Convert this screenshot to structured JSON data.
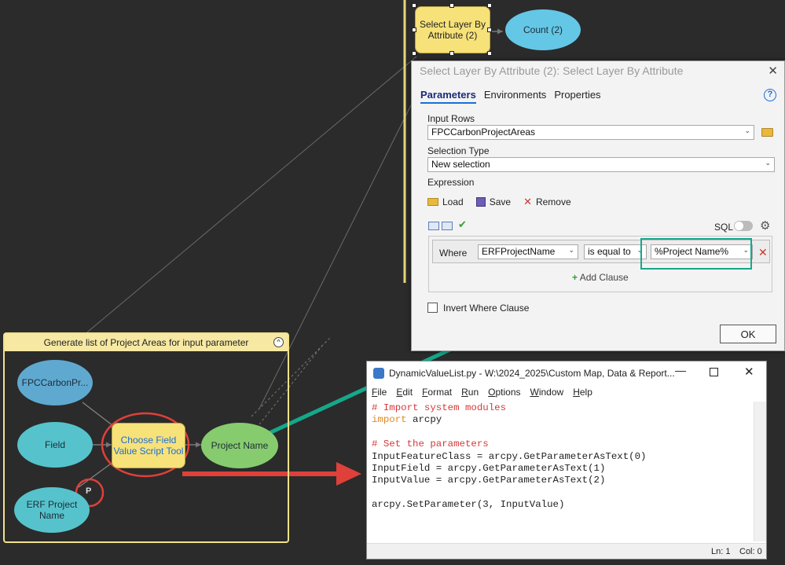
{
  "model": {
    "nodes": {
      "select_layer": "Select Layer By Attribute (2)",
      "count": "Count (2)",
      "fpc_carbon": "FPCCarbonPr...",
      "field": "Field",
      "choose_field": "Choose Field Value Script Tool",
      "project_name": "Project Name",
      "erf_project_name": "ERF Project Name",
      "param_marker": "P"
    },
    "group_title": "Generate list of Project Areas for input parameter",
    "group_collapse": "^"
  },
  "dialog": {
    "title": "Select Layer By Attribute (2): Select Layer By Attribute",
    "close": "✕",
    "tabs": [
      "Parameters",
      "Environments",
      "Properties"
    ],
    "help": "?",
    "input_rows_label": "Input Rows",
    "input_rows_value": "FPCCarbonProjectAreas",
    "selection_type_label": "Selection Type",
    "selection_type_value": "New selection",
    "expression_label": "Expression",
    "load_label": "Load",
    "save_label": "Save",
    "remove_label": "Remove",
    "sql_label": "SQL",
    "where_label": "Where",
    "field_value": "ERFProjectName",
    "operator_value": "is equal to",
    "value_value": "%Project Name%",
    "add_clause_label": "Add Clause",
    "invert_label": "Invert Where Clause",
    "ok_label": "OK"
  },
  "notepad": {
    "title": "DynamicValueList.py - W:\\2024_2025\\Custom Map, Data & Report...",
    "menu": [
      "File",
      "Edit",
      "Format",
      "Run",
      "Options",
      "Window",
      "Help"
    ],
    "lines": [
      {
        "text": "# Import system modules",
        "style": "comment"
      },
      {
        "text": "import",
        "style": "kw",
        "rest": " arcpy"
      },
      {
        "text": "",
        "style": "plain"
      },
      {
        "text": "# Set the parameters",
        "style": "comment"
      },
      {
        "text": "InputFeatureClass = arcpy.GetParameterAsText(0)",
        "style": "plain"
      },
      {
        "text": "InputField = arcpy.GetParameterAsText(1)",
        "style": "plain"
      },
      {
        "text": "InputValue = arcpy.GetParameterAsText(2)",
        "style": "plain"
      },
      {
        "text": "",
        "style": "plain"
      },
      {
        "text": "arcpy.SetParameter(3, InputValue)",
        "style": "plain"
      }
    ],
    "status_line": "Ln: 1",
    "status_col": "Col: 0"
  },
  "colors": {
    "canvas": "#2b2b2b",
    "tool_node": "#f7e27a",
    "data_node": "#56c3cc",
    "output_node": "#86cc6e",
    "highlight_red": "#e0403a",
    "arrow_teal": "#15a88a"
  }
}
